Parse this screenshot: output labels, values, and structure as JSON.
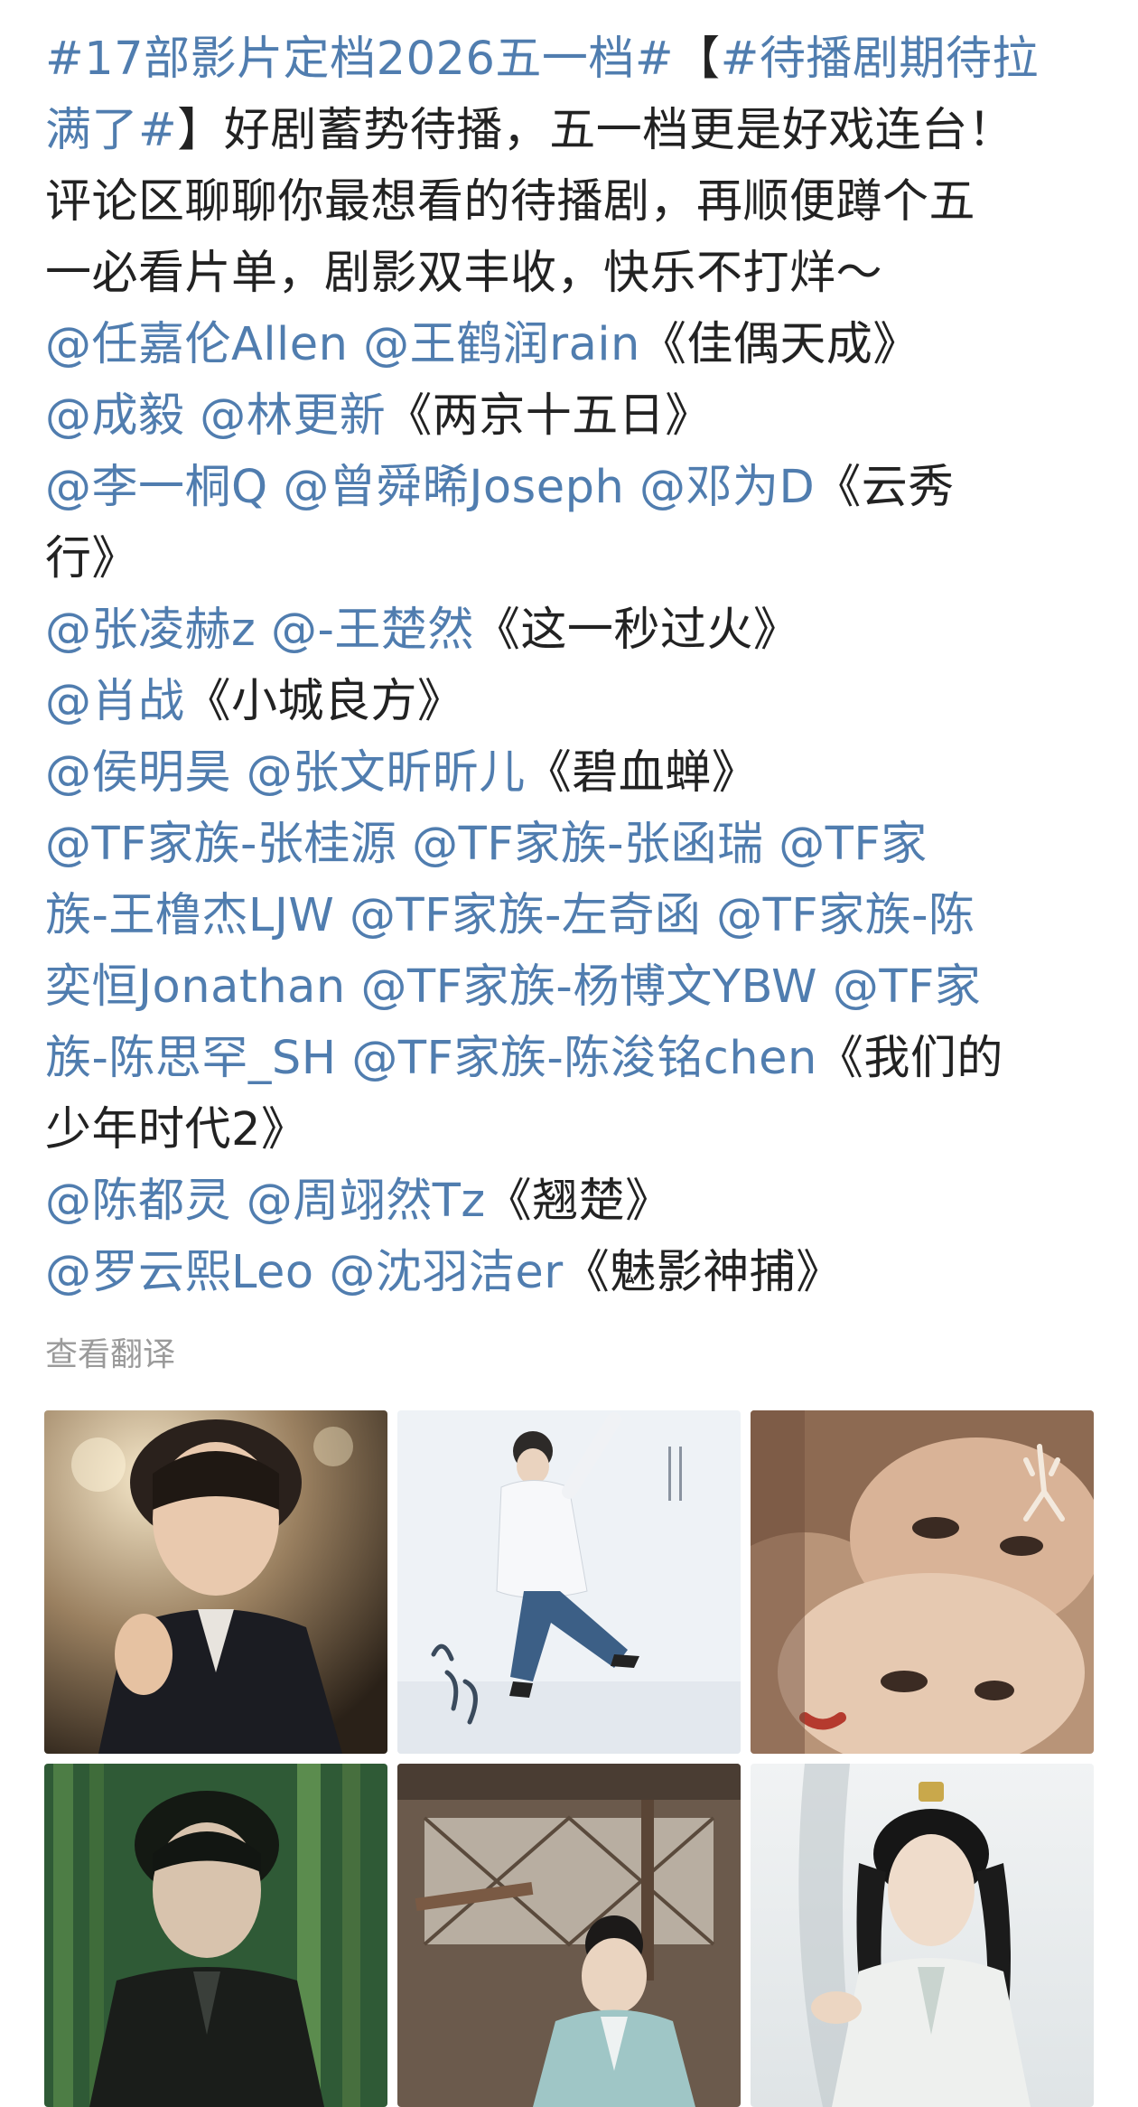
{
  "post": {
    "lines": [
      [
        {
          "t": "#17部影片定档2026五一档#",
          "link": true
        },
        {
          "t": "【",
          "link": false
        },
        {
          "t": "#待播剧期待拉",
          "link": true
        }
      ],
      [
        {
          "t": "满了#",
          "link": true
        },
        {
          "t": "】好剧蓄势待播，五一档更是好戏连台！",
          "link": false
        }
      ],
      [
        {
          "t": "评论区聊聊你最想看的待播剧，再顺便蹲个五",
          "link": false
        }
      ],
      [
        {
          "t": "一必看片单，剧影双丰收，快乐不打烊～",
          "link": false
        }
      ],
      [
        {
          "t": "@任嘉伦Allen",
          "link": true
        },
        {
          "t": " ",
          "link": false
        },
        {
          "t": "@王鹤润rain",
          "link": true
        },
        {
          "t": "《佳偶天成》",
          "link": false
        }
      ],
      [
        {
          "t": "@成毅",
          "link": true
        },
        {
          "t": " ",
          "link": false
        },
        {
          "t": "@林更新",
          "link": true
        },
        {
          "t": "《两京十五日》",
          "link": false
        }
      ],
      [
        {
          "t": "@李一桐Q",
          "link": true
        },
        {
          "t": " ",
          "link": false
        },
        {
          "t": "@曾舜晞Joseph",
          "link": true
        },
        {
          "t": " ",
          "link": false
        },
        {
          "t": "@邓为D",
          "link": true
        },
        {
          "t": "《云秀",
          "link": false
        }
      ],
      [
        {
          "t": "行》",
          "link": false
        }
      ],
      [
        {
          "t": "@张凌赫z",
          "link": true
        },
        {
          "t": " ",
          "link": false
        },
        {
          "t": "@-王楚然",
          "link": true
        },
        {
          "t": "《这一秒过火》",
          "link": false
        }
      ],
      [
        {
          "t": "@肖战",
          "link": true
        },
        {
          "t": "《小城良方》",
          "link": false
        }
      ],
      [
        {
          "t": "@侯明昊",
          "link": true
        },
        {
          "t": " ",
          "link": false
        },
        {
          "t": "@张文昕昕儿",
          "link": true
        },
        {
          "t": "《碧血蝉》",
          "link": false
        }
      ],
      [
        {
          "t": "@TF家族-张桂源",
          "link": true
        },
        {
          "t": " ",
          "link": false
        },
        {
          "t": "@TF家族-张函瑞",
          "link": true
        },
        {
          "t": " ",
          "link": false
        },
        {
          "t": "@TF家",
          "link": true
        }
      ],
      [
        {
          "t": "族-王橹杰LJW",
          "link": true
        },
        {
          "t": " ",
          "link": false
        },
        {
          "t": "@TF家族-左奇函",
          "link": true
        },
        {
          "t": " ",
          "link": false
        },
        {
          "t": "@TF家族-陈",
          "link": true
        }
      ],
      [
        {
          "t": "奕恒Jonathan",
          "link": true
        },
        {
          "t": " ",
          "link": false
        },
        {
          "t": "@TF家族-杨博文YBW",
          "link": true
        },
        {
          "t": " ",
          "link": false
        },
        {
          "t": "@TF家",
          "link": true
        }
      ],
      [
        {
          "t": "族-陈思罕_SH",
          "link": true
        },
        {
          "t": " ",
          "link": false
        },
        {
          "t": "@TF家族-陈浚铭chen",
          "link": true
        },
        {
          "t": "《我们的",
          "link": false
        }
      ],
      [
        {
          "t": "少年时代2》",
          "link": false
        }
      ],
      [
        {
          "t": "@陈都灵",
          "link": true
        },
        {
          "t": " ",
          "link": false
        },
        {
          "t": "@周翊然Tz",
          "link": true
        },
        {
          "t": "《翘楚》",
          "link": false
        }
      ],
      [
        {
          "t": "@罗云熙Leo",
          "link": true
        },
        {
          "t": " ",
          "link": false
        },
        {
          "t": "@沈羽洁er",
          "link": true
        },
        {
          "t": "《魅影神捕》",
          "link": false
        }
      ]
    ],
    "translate_label": "查看翻译",
    "link_color": "#507daf",
    "text_color": "#222222"
  },
  "images": [
    {
      "name": "photo-1"
    },
    {
      "name": "photo-2"
    },
    {
      "name": "photo-3"
    },
    {
      "name": "photo-4"
    },
    {
      "name": "photo-5"
    },
    {
      "name": "photo-6"
    }
  ]
}
